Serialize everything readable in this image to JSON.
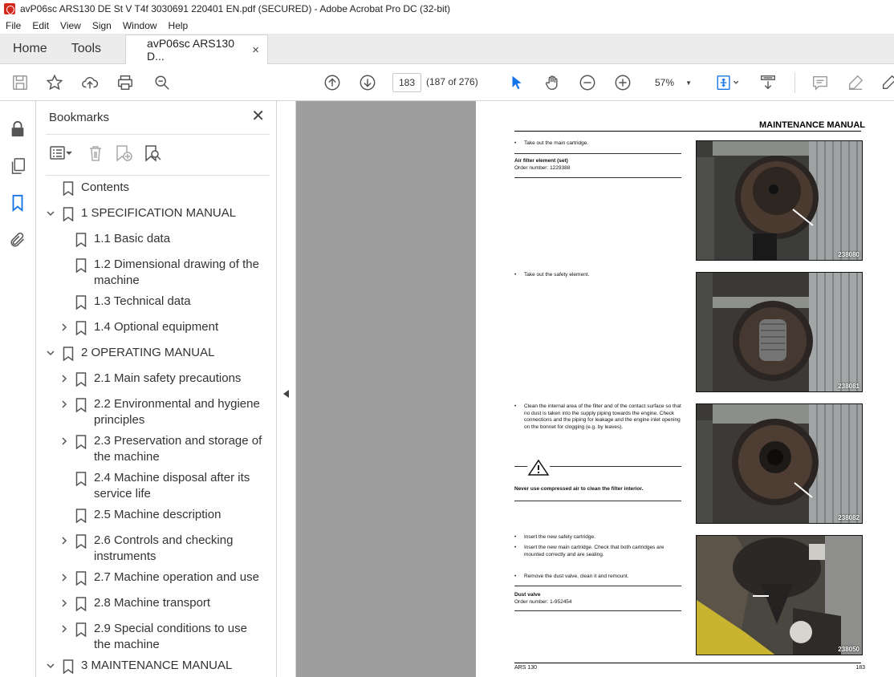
{
  "window": {
    "title": "avP06sc ARS130 DE St V T4f 3030691 220401 EN.pdf (SECURED) - Adobe Acrobat Pro DC (32-bit)"
  },
  "menu": [
    "File",
    "Edit",
    "View",
    "Sign",
    "Window",
    "Help"
  ],
  "tabs": {
    "home": "Home",
    "tools": "Tools",
    "document": "avP06sc ARS130 D...",
    "close": "×"
  },
  "toolbar": {
    "page_number": "183",
    "page_count": "(187 of 276)",
    "zoom": "57%",
    "icons": [
      "save-icon",
      "bookmark-star-icon",
      "upload-icon",
      "print-icon",
      "find-icon",
      "prev-page-icon",
      "next-page-icon",
      "select-cursor-icon",
      "hand-icon",
      "zoom-out-icon",
      "zoom-in-icon",
      "fit-page-icon",
      "scroll-mode-icon",
      "comment-icon",
      "highlight-icon",
      "draw-icon"
    ]
  },
  "rail": [
    "lock-icon",
    "pages-icon",
    "bookmarks-icon",
    "attachments-icon"
  ],
  "bookmarks": {
    "title": "Bookmarks",
    "close": "✕",
    "items": [
      {
        "label": "Contents",
        "level": 0,
        "chevron": "none"
      },
      {
        "label": "1 SPECIFICATION MANUAL",
        "level": 0,
        "chevron": "down"
      },
      {
        "label": "1.1 Basic data",
        "level": 1,
        "chevron": "none"
      },
      {
        "label": "1.2 Dimensional drawing of the machine",
        "level": 1,
        "chevron": "none"
      },
      {
        "label": "1.3 Technical data",
        "level": 1,
        "chevron": "none"
      },
      {
        "label": "1.4 Optional equipment",
        "level": 1,
        "chevron": "right"
      },
      {
        "label": "2 OPERATING MANUAL",
        "level": 0,
        "chevron": "down"
      },
      {
        "label": "2.1 Main safety precautions",
        "level": 1,
        "chevron": "right"
      },
      {
        "label": "2.2 Environmental and hygiene principles",
        "level": 1,
        "chevron": "right"
      },
      {
        "label": "2.3 Preservation and storage of the machine",
        "level": 1,
        "chevron": "right"
      },
      {
        "label": "2.4 Machine disposal after its service life",
        "level": 1,
        "chevron": "none"
      },
      {
        "label": "2.5 Machine description",
        "level": 1,
        "chevron": "none"
      },
      {
        "label": "2.6 Controls and checking instruments",
        "level": 1,
        "chevron": "right"
      },
      {
        "label": "2.7 Machine operation and use",
        "level": 1,
        "chevron": "right"
      },
      {
        "label": "2.8 Machine transport",
        "level": 1,
        "chevron": "right"
      },
      {
        "label": "2.9 Special conditions to use the machine",
        "level": 1,
        "chevron": "right"
      },
      {
        "label": "3 MAINTENANCE MANUAL",
        "level": 0,
        "chevron": "down"
      }
    ]
  },
  "page": {
    "header": "MAINTENANCE MANUAL",
    "step1": "Take out the main cartridge.",
    "part1_title": "Air filter element (set)",
    "part1_order": "Order number: 1229388",
    "step2": "Take out the safety element.",
    "step3": "Clean the internal area of the filter and of the contact surface so that no dust is taken into the supply piping towards the engine. Check connections and the piping for leakage and the engine inlet opening on the bonnet for clogging (e.g. by leaves).",
    "warning": "Never use compressed air to clean the filter interior.",
    "step4a": "Insert the new safety cartridge.",
    "step4b": "Insert the new main cartridge. Check that both cartridges are mounted correctly and are sealing.",
    "step5": "Remove the dust valve, clean it and remount.",
    "part2_title": "Dust valve",
    "part2_order": "Order number: 1-952454",
    "photos": [
      "238080",
      "238081",
      "238082",
      "238050"
    ],
    "footer_left": "ARS 130",
    "footer_right": "183"
  }
}
